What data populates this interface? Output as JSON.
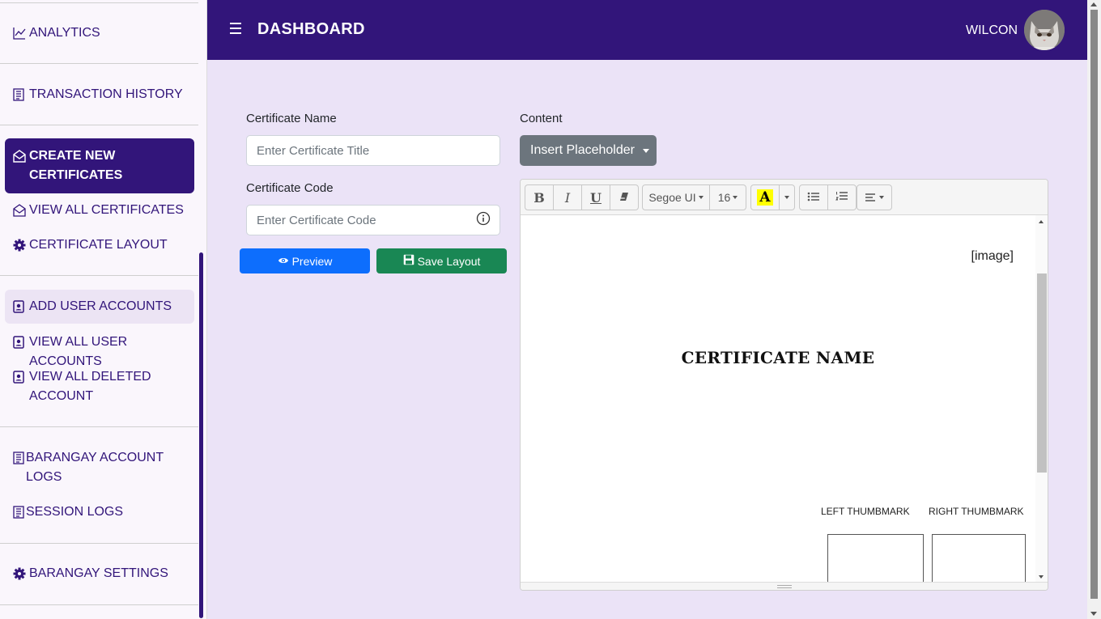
{
  "sidebar": {
    "analytics": "ANALYTICS",
    "transaction_history": "TRANSACTION HISTORY",
    "create_new_certificates": "CREATE NEW CERTIFICATES",
    "view_all_certificates": "VIEW ALL CERTIFICATES",
    "certificate_layout": "CERTIFICATE LAYOUT",
    "add_user_accounts": "ADD USER ACCOUNTS",
    "view_all_user_accounts": "VIEW ALL USER ACCOUNTS",
    "view_all_deleted_account": "VIEW ALL DELETED ACCOUNT",
    "barangay_account_logs": "BARANGAY ACCOUNT LOGS",
    "session_logs": "SESSION LOGS",
    "barangay_settings": "BARANGAY SETTINGS"
  },
  "header": {
    "title": "DASHBOARD",
    "user": "WILCON"
  },
  "form": {
    "cert_name_label": "Certificate Name",
    "cert_name_placeholder": "Enter Certificate Title",
    "cert_code_label": "Certificate Code",
    "cert_code_placeholder": "Enter Certificate Code",
    "preview_label": "Preview",
    "save_label": "Save Layout"
  },
  "content": {
    "label": "Content",
    "insert_placeholder": "Insert Placeholder",
    "toolbar": {
      "bold": "B",
      "italic": "I",
      "underline": "U",
      "font_name": "Segoe UI",
      "font_size": "16",
      "color": "A"
    },
    "body": {
      "image_placeholder": "[image]",
      "certificate_name": "CERTIFICATE NAME",
      "left_thumbmark": "LEFT THUMBMARK",
      "right_thumbmark": "RIGHT THUMBMARK"
    }
  },
  "colors": {
    "brand": "#32157a",
    "page_bg": "#ebe3f7",
    "preview_btn": "#0d6efd",
    "save_btn": "#198754",
    "placeholder_btn": "#6c757d",
    "highlight": "#ffff00"
  }
}
